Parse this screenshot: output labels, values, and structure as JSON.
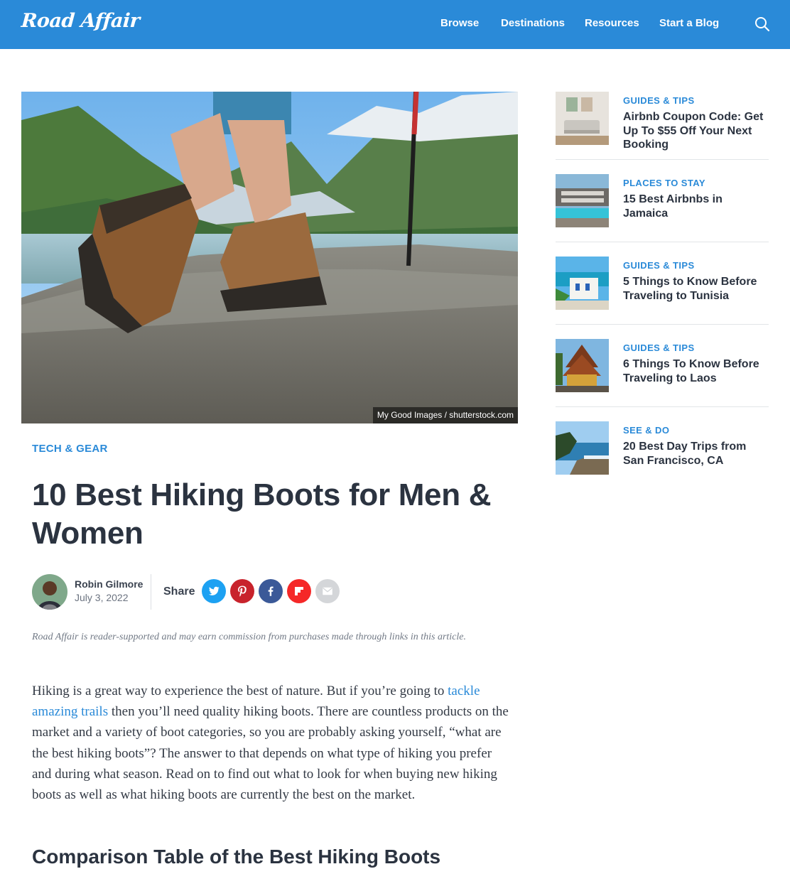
{
  "header": {
    "logo": "Road Affair",
    "nav": [
      "Browse",
      "Destinations",
      "Resources",
      "Start a Blog"
    ],
    "search_icon": "search-icon"
  },
  "hero": {
    "credit": "My Good Images / shutterstock.com"
  },
  "article": {
    "category": "TECH & GEAR",
    "title": "10 Best Hiking Boots for Men & Women",
    "author": "Robin Gilmore",
    "date": "July 3, 2022",
    "share_label": "Share",
    "share_icons": [
      "twitter-icon",
      "pinterest-icon",
      "facebook-icon",
      "flipboard-icon",
      "email-icon"
    ],
    "disclaimer": "Road Affair is reader-supported and may earn commission from purchases made through links in this article.",
    "body_before_link": "Hiking is a great way to experience the best of nature. But if you’re going to ",
    "body_link": "tackle amazing trails",
    "body_after_link": " then you’ll need quality hiking boots. There are countless products on the market and a variety of boot categories, so you are probably asking yourself, “what are the best hiking boots”? The answer to that depends on what type of hiking you prefer and during what season. Read on to find out what to look for when buying new hiking boots as well as what hiking boots are currently the best on the market.",
    "section_heading": "Comparison Table of the Best Hiking Boots"
  },
  "sidebar": {
    "items": [
      {
        "category": "GUIDES & TIPS",
        "title": "Airbnb Coupon Code: Get Up To $55 Off Your Next Booking"
      },
      {
        "category": "PLACES TO STAY",
        "title": "15 Best Airbnbs in Jamaica"
      },
      {
        "category": "GUIDES & TIPS",
        "title": "5 Things to Know Before Traveling to Tunisia"
      },
      {
        "category": "GUIDES & TIPS",
        "title": "6 Things To Know Before Traveling to Laos"
      },
      {
        "category": "SEE & DO",
        "title": "20 Best Day Trips from San Francisco, CA"
      }
    ]
  },
  "colors": {
    "brand_blue": "#2a8ad8",
    "text_dark": "#2b3340",
    "twitter": "#1da1f2",
    "pinterest": "#c8232c",
    "facebook": "#3b5998",
    "flipboard": "#f52828",
    "email": "#d4d6d9"
  }
}
